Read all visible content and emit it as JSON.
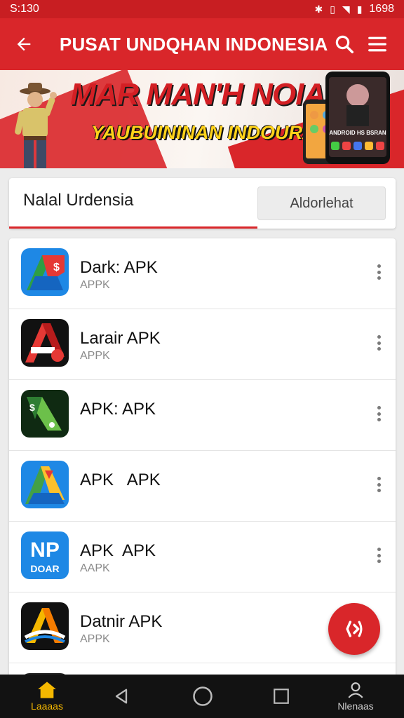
{
  "status_bar": {
    "time": "S:130",
    "clock_right": "1698"
  },
  "app_bar": {
    "title": "PUSAT UNDQHAN INDONESIA"
  },
  "banner": {
    "headline": "MAR MAN'H NOIAS!",
    "subline": "YAUBUININAN INDOURA:",
    "phone_text": "ANDROID HS BSRAN"
  },
  "search": {
    "query": "Nalal Urdensia",
    "button_label": "Aldorlehat"
  },
  "apps": [
    {
      "name": "Dark: APK",
      "subtitle": "APPK"
    },
    {
      "name": "Larair APK",
      "subtitle": "APPK"
    },
    {
      "name": "APK: APK",
      "subtitle": ""
    },
    {
      "name": "APK   APK",
      "subtitle": ""
    },
    {
      "name": "APK  APK",
      "subtitle": "AAPK"
    },
    {
      "name": "Datnir APK",
      "subtitle": "APPK"
    }
  ],
  "app_icon_text": {
    "np": "NP",
    "doar": "DOAR"
  },
  "bottom_nav": {
    "home_label": "Laaaas",
    "profile_label": "Nlenaas"
  },
  "colors": {
    "primary": "#d9262a",
    "accent": "#f5b800",
    "navbar": "#121212"
  }
}
